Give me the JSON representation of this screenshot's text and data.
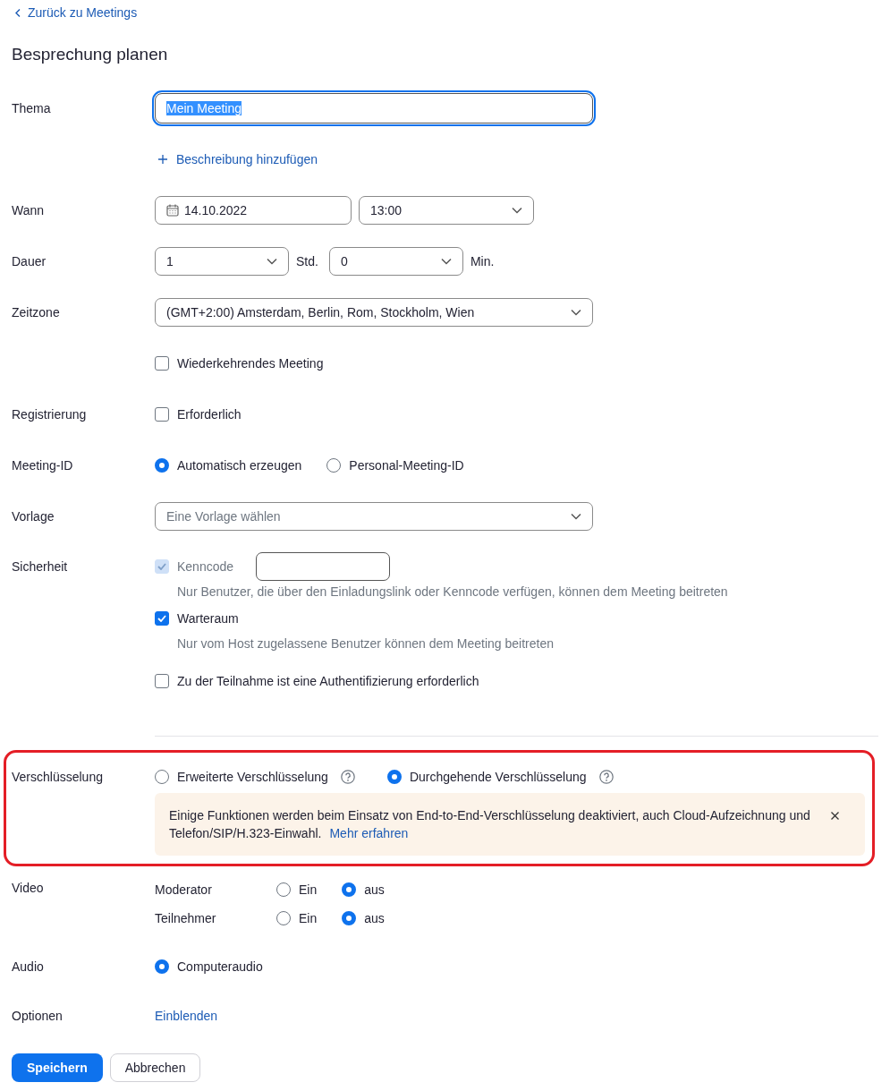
{
  "back_link": "Zurück zu Meetings",
  "title": "Besprechung planen",
  "rows": [
    {
      "kind": "text-input",
      "label": "Thema",
      "value": "Mein Meeting",
      "focused": true,
      "text_selected": true
    },
    {
      "kind": "add-link",
      "text": "Beschreibung hinzufügen"
    },
    {
      "kind": "datetime",
      "label": "Wann",
      "date": "14.10.2022",
      "time": "13:00"
    },
    {
      "kind": "duration",
      "label": "Dauer",
      "hours": "1",
      "hours_unit": "Std.",
      "minutes": "0",
      "minutes_unit": "Min."
    },
    {
      "kind": "select",
      "label": "Zeitzone",
      "value": "(GMT+2:00) Amsterdam, Berlin, Rom, Stockholm, Wien"
    },
    {
      "kind": "checkbox",
      "options": [
        {
          "label": "Wiederkehrendes Meeting",
          "checked": false
        }
      ]
    },
    {
      "kind": "checkbox",
      "label": "Registrierung",
      "options": [
        {
          "label": "Erforderlich",
          "checked": false
        }
      ]
    },
    {
      "kind": "radio",
      "label": "Meeting-ID",
      "options": [
        {
          "label": "Automatisch erzeugen",
          "selected": true
        },
        {
          "label": "Personal-Meeting-ID",
          "selected": false
        }
      ]
    },
    {
      "kind": "select",
      "label": "Vorlage",
      "placeholder": "Eine Vorlage wählen"
    },
    {
      "kind": "security",
      "label": "Sicherheit",
      "options": [
        {
          "label": "Kenncode",
          "checked": true,
          "disabled": true,
          "passcode_field": true,
          "hint": "Nur Benutzer, die über den Einladungslink oder Kenncode verfügen, können dem Meeting beitreten"
        },
        {
          "label": "Warteraum",
          "checked": true,
          "disabled": false,
          "hint": "Nur vom Host zugelassene Benutzer können dem Meeting beitreten"
        },
        {
          "label": "Zu der Teilnahme ist eine Authentifizierung erforderlich",
          "checked": false,
          "disabled": false
        }
      ]
    },
    {
      "kind": "radio",
      "label": "Verschlüsselung",
      "highlighted": true,
      "divider_before": true,
      "options": [
        {
          "label": "Erweiterte Verschlüsselung",
          "selected": false,
          "help": true
        },
        {
          "label": "Durchgehende Verschlüsselung",
          "selected": true,
          "help": true
        }
      ],
      "notice": {
        "text": "Einige Funktionen werden beim Einsatz von End-to-End-Verschlüsselung deaktiviert, auch Cloud-Aufzeichnung und Telefon/SIP/H.323-Einwahl.",
        "link": "Mehr erfahren",
        "closable": true
      }
    },
    {
      "kind": "video",
      "label": "Video",
      "lines": [
        {
          "name": "Moderator",
          "options": [
            {
              "label": "Ein",
              "selected": false
            },
            {
              "label": "aus",
              "selected": true
            }
          ]
        },
        {
          "name": "Teilnehmer",
          "options": [
            {
              "label": "Ein",
              "selected": false
            },
            {
              "label": "aus",
              "selected": true
            }
          ]
        }
      ]
    },
    {
      "kind": "radio",
      "label": "Audio",
      "options": [
        {
          "label": "Computeraudio",
          "selected": true
        }
      ]
    },
    {
      "kind": "link",
      "label": "Optionen",
      "text": "Einblenden"
    }
  ],
  "buttons": [
    {
      "label": "Speichern",
      "primary": true
    },
    {
      "label": "Abbrechen",
      "primary": false
    }
  ]
}
